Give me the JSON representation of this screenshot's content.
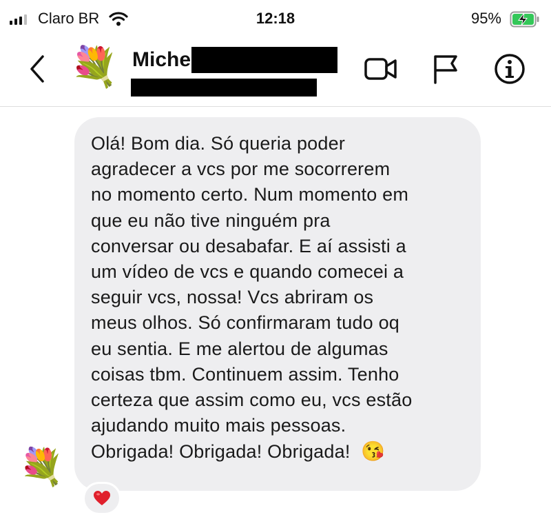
{
  "status_bar": {
    "carrier": "Claro BR",
    "time": "12:18",
    "battery": "95%",
    "icons": [
      "signal-icon",
      "wifi-icon",
      "battery-charging-icon"
    ]
  },
  "header": {
    "contact_name": "Miche",
    "avatar_emoji": "💐",
    "icons": [
      "back-icon",
      "video-call-icon",
      "flag-icon",
      "info-icon"
    ]
  },
  "message": {
    "text": "Olá! Bom dia. Só queria poder\nagradecer a vcs por me socorrerem\nno momento certo. Num momento em\nque eu não tive ninguém pra\nconversar ou desabafar. E aí assisti a\num vídeo de vcs e quando comecei a\nseguir vcs, nossa! Vcs abriram os\nmeus olhos. Só confirmaram tudo oq\neu sentia. E me alertou de algumas\ncoisas tbm. Continuem assim. Tenho\ncerteza que assim como eu, vcs estão\najudando muito mais pessoas.\nObrigada! Obrigada! Obrigada!",
    "emoji": "😘",
    "sender_avatar_emoji": "💐",
    "reaction": "❤️"
  },
  "colors": {
    "bubble": "#eeeef0",
    "battery_fill": "#34c759",
    "reaction_heart": "#e0202c"
  }
}
